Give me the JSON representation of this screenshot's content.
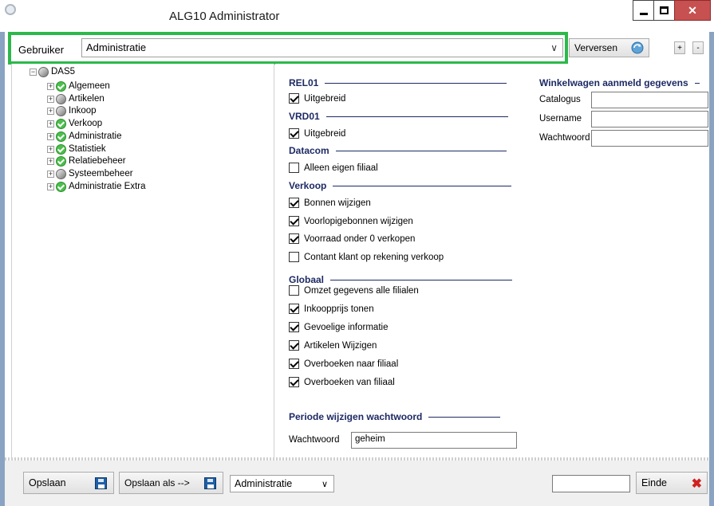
{
  "window": {
    "title": "ALG10  Administrator"
  },
  "user": {
    "label": "Gebruiker",
    "value": "Administratie"
  },
  "toolbar": {
    "refresh_label": "Verversen",
    "plus_label": "+",
    "minus_label": "-"
  },
  "tree": {
    "root": "DAS5",
    "items": [
      {
        "label": "Algemeen",
        "status": "ok"
      },
      {
        "label": "Artikelen",
        "status": "gray"
      },
      {
        "label": "Inkoop",
        "status": "gray"
      },
      {
        "label": "Verkoop",
        "status": "ok"
      },
      {
        "label": "Administratie",
        "status": "ok"
      },
      {
        "label": "Statistiek",
        "status": "ok"
      },
      {
        "label": "Relatiebeheer",
        "status": "ok"
      },
      {
        "label": "Systeembeheer",
        "status": "gray"
      },
      {
        "label": "Administratie Extra",
        "status": "ok"
      }
    ]
  },
  "settings": {
    "rel01": {
      "title": "REL01",
      "items": [
        {
          "label": "Uitgebreid",
          "checked": true
        }
      ]
    },
    "vrd01": {
      "title": "VRD01",
      "items": [
        {
          "label": "Uitgebreid",
          "checked": true
        }
      ]
    },
    "datacom": {
      "title": "Datacom",
      "items": [
        {
          "label": "Alleen eigen filiaal",
          "checked": false
        }
      ]
    },
    "verkoop": {
      "title": "Verkoop",
      "items": [
        {
          "label": "Bonnen wijzigen",
          "checked": true
        },
        {
          "label": "Voorlopigebonnen wijzigen",
          "checked": true
        },
        {
          "label": "Voorraad onder 0 verkopen",
          "checked": true
        },
        {
          "label": "Contant klant op rekening verkoop",
          "checked": false
        }
      ]
    },
    "globaal": {
      "title": "Globaal",
      "items": [
        {
          "label": "Omzet gegevens alle filialen",
          "checked": false
        },
        {
          "label": "Inkoopprijs tonen",
          "checked": true
        },
        {
          "label": "Gevoelige informatie",
          "checked": true
        },
        {
          "label": "Artikelen Wijzigen",
          "checked": true
        },
        {
          "label": "Overboeken naar filiaal",
          "checked": true
        },
        {
          "label": "Overboeken van filiaal",
          "checked": true
        }
      ]
    },
    "password_period": {
      "title": "Periode wijzigen wachtwoord",
      "label": "Wachtwoord",
      "value": "geheim"
    }
  },
  "webshop": {
    "title": "Winkelwagen aanmeld gegevens",
    "fields": [
      {
        "label": "Catalogus",
        "value": ""
      },
      {
        "label": "Username",
        "value": ""
      },
      {
        "label": "Wachtwoord",
        "value": ""
      }
    ]
  },
  "footer": {
    "save_label": "Opslaan",
    "saveas_label": "Opslaan als -->",
    "saveas_value": "Administratie",
    "exit_label": "Einde"
  },
  "colors": {
    "highlight": "#2db84b",
    "section": "#1d2a64",
    "frame": "#8aa3c2"
  }
}
